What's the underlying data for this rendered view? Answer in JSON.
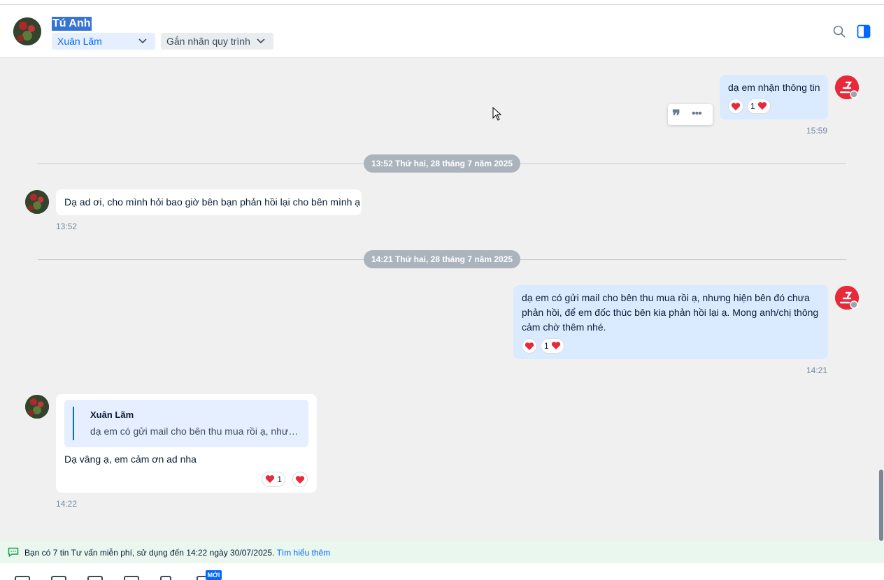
{
  "header": {
    "name": "Tú Anh",
    "assignee": "Xuân Lãm",
    "label_placeholder": "Gắn nhãn quy trình"
  },
  "messages": [
    {
      "text": "dạ em nhận thông tin",
      "time": "15:59",
      "reaction_count": "1"
    },
    {
      "date": "13:52 Thứ hai, 28 tháng 7 năm 2025"
    },
    {
      "text": "Dạ ad ơi, cho mình hỏi bao giờ bên bạn phản hồi lại cho bên mình ạ",
      "time": "13:52"
    },
    {
      "date": "14:21 Thứ hai, 28 tháng 7 năm 2025"
    },
    {
      "text": "dạ em có gửi mail cho bên thu mua rồi ạ, nhưng hiện bên đó chưa phản hồi, để em đốc thúc bên kia phản hồi lại ạ. Mong anh/chị thông cảm chờ thêm nhé.",
      "time": "14:21",
      "reaction_count": "1"
    },
    {
      "quote_name": "Xuân Lãm",
      "quote_text": "dạ em có gửi mail cho bên thu mua rồi ạ, nhưng hiện bên đó chưa phản hồi, để em đốc thúc bên kia phản hồi lại ạ.",
      "text": "Dạ vâng ạ, em cảm ơn ad nha",
      "time": "14:22",
      "reaction_count": "1"
    }
  ],
  "notice": {
    "text": "Bạn có 7 tin Tư vấn miễn phí, sử dụng đến 14:22 ngày 30/07/2025.",
    "link": "Tìm hiểu thêm"
  },
  "toolbar": {
    "new_badge": "MỚI"
  },
  "colors": {
    "accent": "#0068ff",
    "out_bubble": "#dbebff",
    "brand": "#e8293a",
    "heart": "#e8293a"
  },
  "icons": [
    "search-icon",
    "side-panel-icon",
    "chevron-down-icon",
    "quote-icon",
    "more-icon",
    "heart-icon",
    "chat-bubble-icon",
    "cursor-icon"
  ]
}
